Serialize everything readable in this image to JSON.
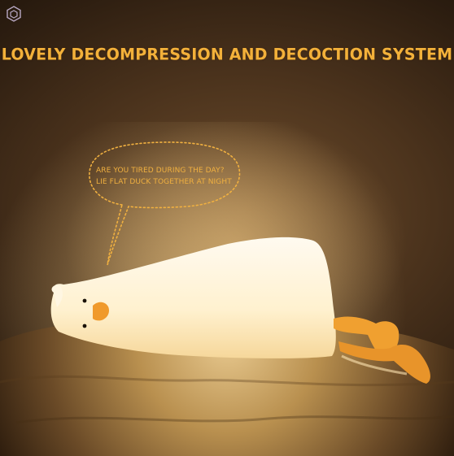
{
  "title": "LOVELY DECOMPRESSION AND DECOCTION SYSTEM",
  "bubble": {
    "line1": "ARE YOU TIRED DURING THE DAY?",
    "line2": "LIE FLAT DUCK TOGETHER AT NIGHT"
  },
  "colors": {
    "title": "#f3b13a",
    "bubble_text": "#f0b040",
    "duck_glow": "#fff3d6",
    "duck_feet": "#f0a030"
  },
  "icons": [
    "watermark-logo-icon"
  ]
}
